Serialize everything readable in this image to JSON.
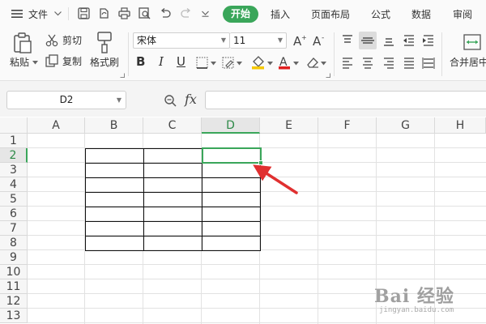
{
  "menu": {
    "file_label": "文件",
    "tabs": [
      "开始",
      "插入",
      "页面布局",
      "公式",
      "数据",
      "审阅"
    ],
    "active_tab": "开始"
  },
  "ribbon": {
    "paste_label": "粘贴",
    "cut_label": "剪切",
    "copy_label": "复制",
    "format_painter_label": "格式刷",
    "font_name": "宋体",
    "font_size": "11",
    "bold": "B",
    "italic": "I",
    "underline": "U",
    "merge_label": "合并居中"
  },
  "formula_bar": {
    "cell_ref": "D2",
    "fx_label": "fx",
    "value": ""
  },
  "grid": {
    "columns": [
      "A",
      "B",
      "C",
      "D",
      "E",
      "F",
      "G",
      "H"
    ],
    "rows": [
      "1",
      "2",
      "3",
      "4",
      "5",
      "6",
      "7",
      "8",
      "9",
      "10",
      "11",
      "12",
      "13"
    ],
    "selected_cell": "D2",
    "selected_column": "D",
    "selected_row": "2",
    "bordered_range": "B2:D8"
  },
  "colors": {
    "accent": "#3aa65a",
    "arrow": "#e03030"
  },
  "watermark": {
    "text": "Bai 经验",
    "url": "jingyan.baidu.com"
  }
}
